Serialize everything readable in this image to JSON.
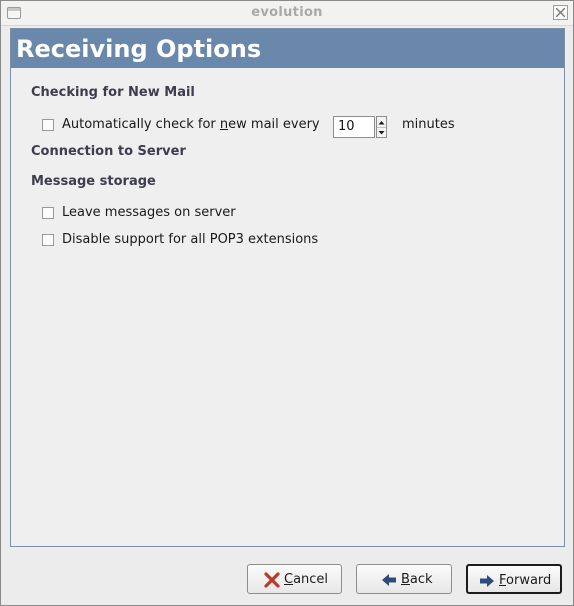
{
  "window": {
    "title": "evolution"
  },
  "header": {
    "title": "Receiving Options"
  },
  "sections": {
    "checking": "Checking for New Mail",
    "connection": "Connection to Server",
    "storage": "Message storage"
  },
  "auto_check": {
    "label_before": "Automatically check for ",
    "label_underline": "n",
    "label_after": "ew mail every",
    "value": "10",
    "unit": "minutes",
    "checked": false
  },
  "options": {
    "leave_on_server": "Leave messages on server",
    "disable_pop3": "Disable support for all POP3 extensions"
  },
  "buttons": {
    "cancel_u": "C",
    "cancel_rest": "ancel",
    "back_u": "B",
    "back_rest": "ack",
    "forward_u": "F",
    "forward_rest": "orward"
  },
  "colors": {
    "header_bg": "#6a88ab",
    "cancel_icon": "#c0392b",
    "arrow_icon": "#2c4d7c"
  }
}
